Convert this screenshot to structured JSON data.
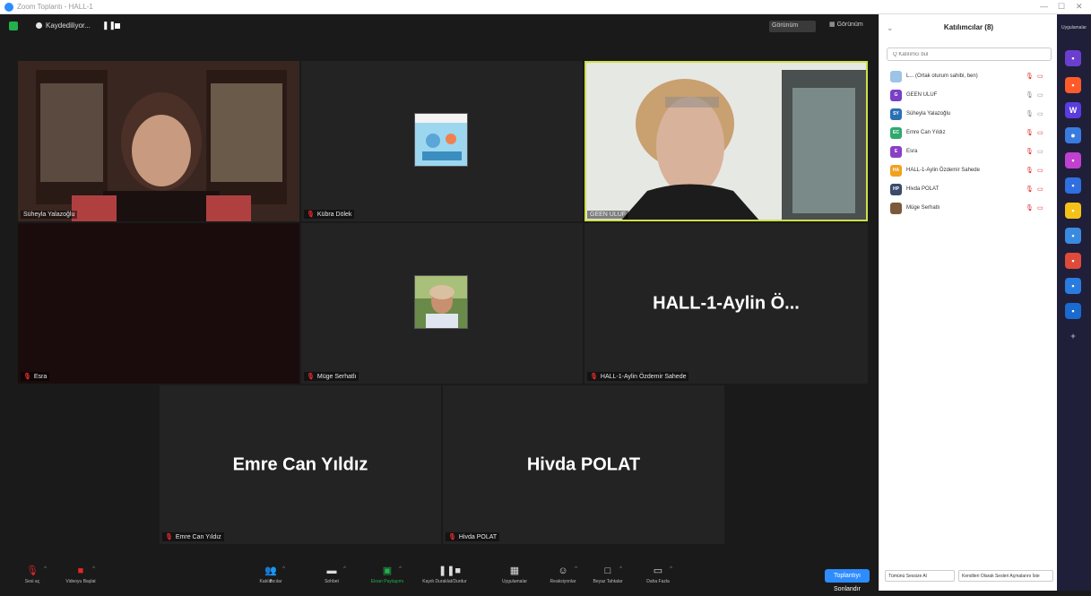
{
  "window": {
    "title": "Zoom Toplantı - HALL-1"
  },
  "topbar": {
    "recording_label": "Kaydediliyor...",
    "view_label": "Görünüm",
    "grid_label": "Görünüm"
  },
  "tiles": [
    {
      "name": "Süheyla Yalazoğlu",
      "muted": false
    },
    {
      "name": "Kübra Dölek",
      "muted": true
    },
    {
      "name": "GEEN ULUF",
      "muted": false
    },
    {
      "name": "Esra",
      "muted": true
    },
    {
      "name": "Müge Serhatlı",
      "muted": true
    },
    {
      "name": "HALL-1-Aylin Özdemir Sahede",
      "muted": true,
      "big": "HALL-1-Aylin Ö..."
    },
    {
      "name": "Emre Can Yıldız",
      "muted": true,
      "big": "Emre Can Yıldız"
    },
    {
      "name": "Hivda POLAT",
      "muted": true,
      "big": "Hivda POLAT"
    }
  ],
  "toolbar": {
    "audio": "Sesi aç",
    "video": "Videoyu Başlat",
    "participants": "Katılımcılar",
    "participants_count": "8",
    "chat": "Sohbet",
    "share": "Ekran Paylaşımı",
    "record": "Kaydı Duraklat/Durdur",
    "apps": "Uygulamalar",
    "reactions": "Reaksiyonlar",
    "whiteboard": "Beyaz Tahtalar",
    "more": "Daha Fazla",
    "end": "Toplantıyı Sonlandır"
  },
  "panel": {
    "title": "Katılımcılar (8)",
    "search_placeholder": "Q Katılımcı bul",
    "participants": [
      {
        "initials": "",
        "color": "#9dc3e6",
        "name": "L... (Ortak oturum sahibi, ben)",
        "mic_on": false,
        "cam_on": false
      },
      {
        "initials": "G",
        "color": "#7a3fc6",
        "name": "GEEN ULUF",
        "mic_on": true,
        "cam_on": true
      },
      {
        "initials": "SY",
        "color": "#2a6fb5",
        "name": "Süheyla Yalazoğlu",
        "mic_on": true,
        "cam_on": true
      },
      {
        "initials": "EC",
        "color": "#2fa86d",
        "name": "Emre Can Yıldız",
        "mic_on": false,
        "cam_on": false
      },
      {
        "initials": "E",
        "color": "#8a3fc6",
        "name": "Esra",
        "mic_on": false,
        "cam_on": true
      },
      {
        "initials": "HA",
        "color": "#f0a21f",
        "name": "HALL-1-Aylin Özdemir Sahede",
        "mic_on": false,
        "cam_on": false
      },
      {
        "initials": "HP",
        "color": "#3b4a6b",
        "name": "Hivda POLAT",
        "mic_on": false,
        "cam_on": false
      },
      {
        "initials": "",
        "color": "#7a5a3a",
        "name": "Müge Serhatlı",
        "mic_on": false,
        "cam_on": false
      }
    ],
    "footer_mute_all": "Tümünü Sessize Al",
    "footer_ask_unmute": "Kendileri Olarak Sesleri Açmalarını İste"
  },
  "apps_panel": {
    "label": "Uygulamalar"
  }
}
